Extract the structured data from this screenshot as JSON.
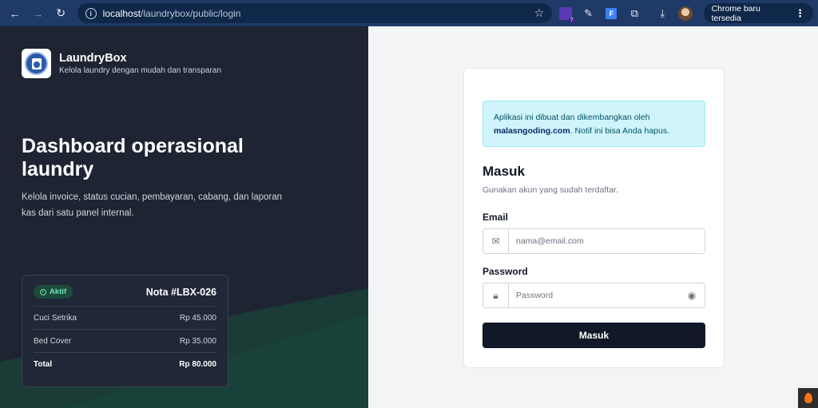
{
  "browser": {
    "url_host": "localhost",
    "url_path": "/laundrybox/public/login",
    "update_label": "Chrome baru tersedia",
    "ext_badge_count": "7",
    "ext_f_letter": "F"
  },
  "brand": {
    "name": "LaundryBox",
    "tagline": "Kelola laundry dengan mudah dan transparan"
  },
  "hero": {
    "title": "Dashboard operasional laundry",
    "subtitle": "Kelola invoice, status cucian, pembayaran, cabang, dan laporan kas dari satu panel internal."
  },
  "nota": {
    "status": "Aktif",
    "title": "Nota #LBX-026",
    "items": [
      {
        "name": "Cuci Setrika",
        "price": "Rp 45.000"
      },
      {
        "name": "Bed Cover",
        "price": "Rp 35.000"
      }
    ],
    "total_label": "Total",
    "total_value": "Rp 80.000"
  },
  "notice": {
    "text_before": "Aplikasi ini dibuat dan dikembangkan oleh",
    "link": "malasngoding.com",
    "text_after": ". Notif ini bisa Anda hapus."
  },
  "login": {
    "title": "Masuk",
    "subtitle": "Gunakan akun yang sudah terdaftar.",
    "email_label": "Email",
    "email_placeholder": "nama@email.com",
    "password_label": "Password",
    "password_placeholder": "Password",
    "submit_label": "Masuk"
  },
  "colors": {
    "left_bg": "#1e2432",
    "accent_green": "#1a4a3c",
    "button_dark": "#111827",
    "notice_bg": "#cff4fc"
  }
}
